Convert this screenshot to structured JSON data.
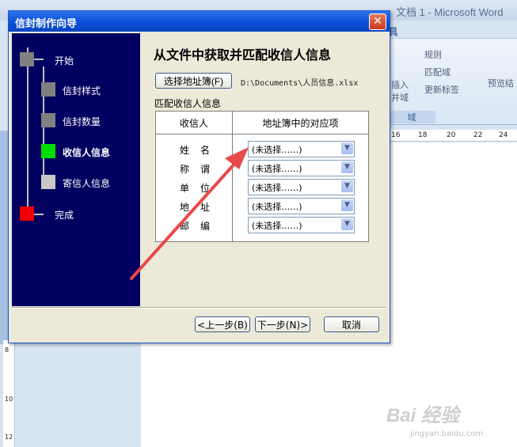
{
  "word": {
    "title": "文档 1 - Microsoft Word",
    "ribbon_tab": "具",
    "ribbon_items": [
      "规则",
      "匹配域",
      "更新标签",
      "插入",
      "并域",
      "预览结"
    ],
    "group_label": "域",
    "hruler_ticks": [
      "16",
      "18",
      "20",
      "22",
      "24"
    ],
    "vruler_ticks": [
      "8",
      "10",
      "12"
    ]
  },
  "dialog": {
    "title": "信封制作向导",
    "close_glyph": "✕",
    "steps": [
      {
        "label": "开始",
        "color": "#808080"
      },
      {
        "label": "信封样式",
        "color": "#808080"
      },
      {
        "label": "信封数量",
        "color": "#808080"
      },
      {
        "label": "收信人信息",
        "color": "#00dd00"
      },
      {
        "label": "寄信人信息",
        "color": "#c8c8c8"
      },
      {
        "label": "完成",
        "color": "#ee0000"
      }
    ],
    "content_title": "从文件中获取并匹配收信人信息",
    "select_book_label": "选择地址簿(F)",
    "file_path": "D:\\Documents\\人员信息.xlsx",
    "match_label": "匹配收信人信息",
    "table_headers": [
      "收信人",
      "地址簿中的对应项"
    ],
    "fields": [
      {
        "label": "姓名",
        "value": "(未选择……)"
      },
      {
        "label": "称谓",
        "value": "(未选择……)"
      },
      {
        "label": "单位",
        "value": "(未选择……)"
      },
      {
        "label": "地址",
        "value": "(未选择……)"
      },
      {
        "label": "邮编",
        "value": "(未选择……)"
      }
    ],
    "dropdown_glyph": "▼",
    "buttons": {
      "prev": "<上一步(B)",
      "next": "下一步(N)>",
      "cancel": "取消"
    }
  },
  "watermark": {
    "main": "Bai 经验",
    "sub": "jingyan.baidu.com"
  },
  "colors": {
    "wizard_panel": "#000060",
    "titlebar": "#0b4fd8",
    "arrow": "#e84a4a"
  }
}
